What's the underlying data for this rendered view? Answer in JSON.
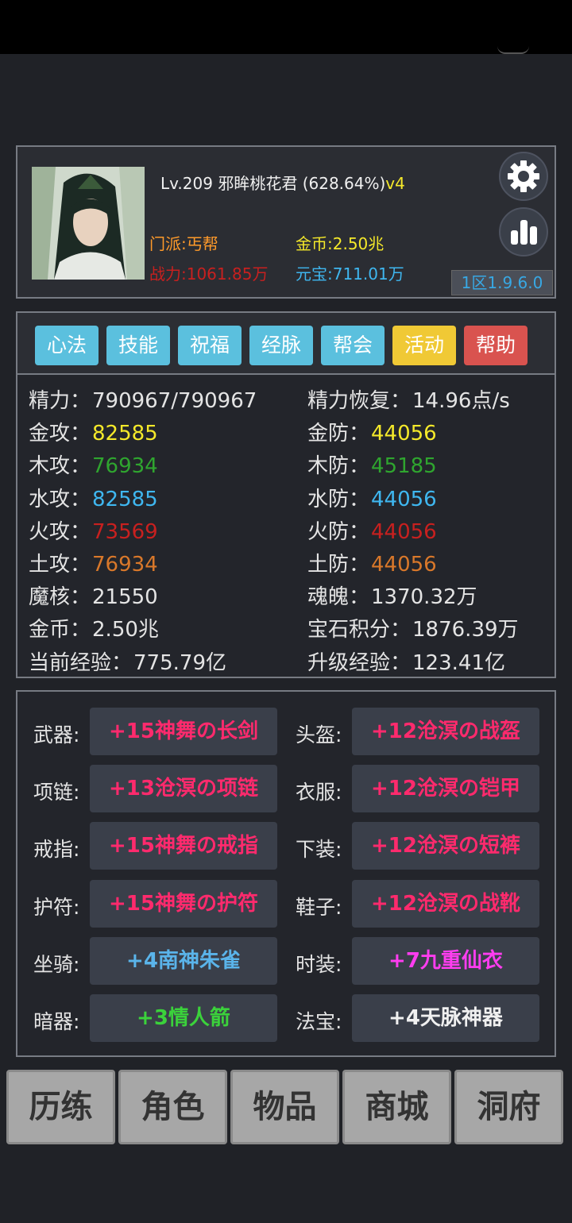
{
  "header": {
    "level": "Lv.209",
    "name": "邪眸桃花君",
    "progress": "(628.64%)",
    "vip": "v4",
    "sect": "门派:丐帮",
    "power": "战力:1061.85万",
    "gold": "金币:2.50兆",
    "ingot": "元宝:711.01万",
    "version": "1区1.9.6.0"
  },
  "tabs": [
    "心法",
    "技能",
    "祝福",
    "经脉",
    "帮会",
    "活动",
    "帮助"
  ],
  "stats": {
    "left": [
      {
        "label": "精力：",
        "value": "790967/790967",
        "color": "#e4e4e4"
      },
      {
        "label": "金攻：",
        "value": "82585",
        "color": "#f5e92a"
      },
      {
        "label": "木攻：",
        "value": "76934",
        "color": "#2fa52f"
      },
      {
        "label": "水攻：",
        "value": "82585",
        "color": "#3fb7f0"
      },
      {
        "label": "火攻：",
        "value": "73569",
        "color": "#c8201f"
      },
      {
        "label": "土攻：",
        "value": "76934",
        "color": "#d9782a"
      },
      {
        "label": "魔核：",
        "value": "21550",
        "color": "#e4e4e4"
      },
      {
        "label": "金币：",
        "value": "2.50兆",
        "color": "#e4e4e4"
      },
      {
        "label": "当前经验：",
        "value": "775.79亿",
        "color": "#e4e4e4"
      }
    ],
    "right": [
      {
        "label": "精力恢复：",
        "value": "14.96点/s",
        "color": "#e4e4e4"
      },
      {
        "label": "金防：",
        "value": "44056",
        "color": "#f5e92a"
      },
      {
        "label": "木防：",
        "value": "45185",
        "color": "#2fa52f"
      },
      {
        "label": "水防：",
        "value": "44056",
        "color": "#3fb7f0"
      },
      {
        "label": "火防：",
        "value": "44056",
        "color": "#c8201f"
      },
      {
        "label": "土防：",
        "value": "44056",
        "color": "#d9782a"
      },
      {
        "label": "魂魄：",
        "value": "1370.32万",
        "color": "#e4e4e4"
      },
      {
        "label": "宝石积分：",
        "value": "1876.39万",
        "color": "#e4e4e4"
      },
      {
        "label": "升级经验：",
        "value": "123.41亿",
        "color": "#e4e4e4"
      }
    ]
  },
  "equipment": {
    "left": [
      {
        "label": "武器:",
        "item": "+15神舞の长剑",
        "color": "#ff2a6d"
      },
      {
        "label": "项链:",
        "item": "+13沧溟の项链",
        "color": "#ff2a6d"
      },
      {
        "label": "戒指:",
        "item": "+15神舞の戒指",
        "color": "#ff2a6d"
      },
      {
        "label": "护符:",
        "item": "+15神舞の护符",
        "color": "#ff2a6d"
      },
      {
        "label": "坐骑:",
        "item": "+4南神朱雀",
        "color": "#5ab4ea"
      },
      {
        "label": "暗器:",
        "item": "+3情人箭",
        "color": "#3bd23b"
      }
    ],
    "right": [
      {
        "label": "头盔:",
        "item": "+12沧溟の战盔",
        "color": "#ff2a6d"
      },
      {
        "label": "衣服:",
        "item": "+12沧溟の铠甲",
        "color": "#ff2a6d"
      },
      {
        "label": "下装:",
        "item": "+12沧溟の短裤",
        "color": "#ff2a6d"
      },
      {
        "label": "鞋子:",
        "item": "+12沧溟の战靴",
        "color": "#ff2a6d"
      },
      {
        "label": "时装:",
        "item": "+7九重仙衣",
        "color": "#ff3df0"
      },
      {
        "label": "法宝:",
        "item": "+4天脉神器",
        "color": "#f0f0f0"
      }
    ]
  },
  "nav": [
    "历练",
    "角色",
    "物品",
    "商城",
    "洞府"
  ]
}
